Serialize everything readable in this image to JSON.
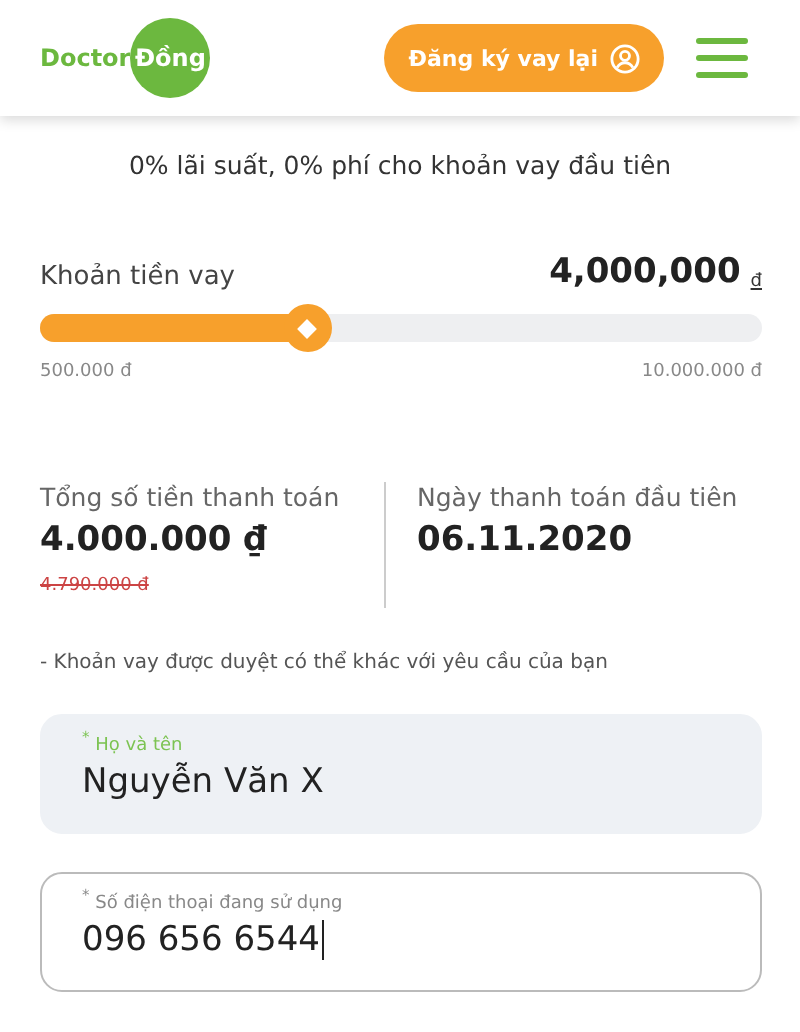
{
  "header": {
    "logo": {
      "text": "Doctor",
      "badge": "Đồng"
    },
    "cta": "Đăng ký vay lại"
  },
  "tagline": "0% lãi suất, 0% phí cho khoản vay đầu tiên",
  "loan": {
    "label": "Khoản tiền vay",
    "amount": "4,000,000",
    "currency": "đ",
    "level": 0.37,
    "min": "500.000 đ",
    "max": "10.000.000 đ"
  },
  "summary": [
    {
      "label": "Tổng số tiền thanh toán",
      "value": "4.000.000 ₫",
      "old_value": "4.790.000 đ"
    },
    {
      "label": "Ngày thanh toán đầu tiên",
      "value": "06.11.2020"
    }
  ],
  "note": "- Khoản vay được duyệt có thể khác với yêu cầu của bạn",
  "fields": [
    {
      "label": "$^{*}$ Họ và tên",
      "value": "Nguyễn Văn X",
      "focused": false
    },
    {
      "label": "$^{*}$ Số điện thoại đang sử dụng",
      "value": "096 656 6544",
      "focused": true
    }
  ]
}
